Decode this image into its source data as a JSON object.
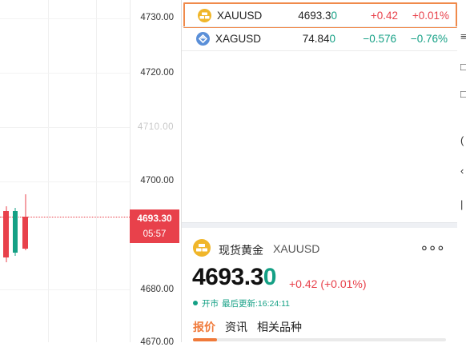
{
  "axis": {
    "ticks": [
      "4730.00",
      "4720.00",
      "4710.00",
      "4700.00",
      "4680.00",
      "4670.00"
    ]
  },
  "price_tag": {
    "price": "4693.30",
    "countdown": "05:57"
  },
  "watchlist": [
    {
      "symbol": "XAUUSD",
      "price_main": "4693.3",
      "price_last": "0",
      "change": "+0.42",
      "percent": "+0.01%",
      "icon": "gold-bars-icon",
      "selected": true,
      "direction": "up"
    },
    {
      "symbol": "XAGUSD",
      "price_main": "74.84",
      "price_last": "0",
      "change": "−0.576",
      "percent": "−0.76%",
      "icon": "silver-icon",
      "selected": false,
      "direction": "down"
    }
  ],
  "detail": {
    "name": "现货黄金",
    "symbol": "XAUUSD",
    "price_main": "4693.3",
    "price_last": "0",
    "change": "+0.42 (+0.01%)",
    "status": "开市",
    "updated": "最后更新:16:24:11",
    "tabs": [
      "报价",
      "资讯",
      "相关品种"
    ]
  },
  "toolbar": {
    "glyphs": [
      "≡",
      "□",
      "□",
      "(",
      "‹",
      "|"
    ]
  },
  "colors": {
    "up": "#e8414b",
    "down": "#14a085",
    "accent": "#f07a3a",
    "gold": "#f0b62a",
    "silver": "#5a8fd8"
  }
}
